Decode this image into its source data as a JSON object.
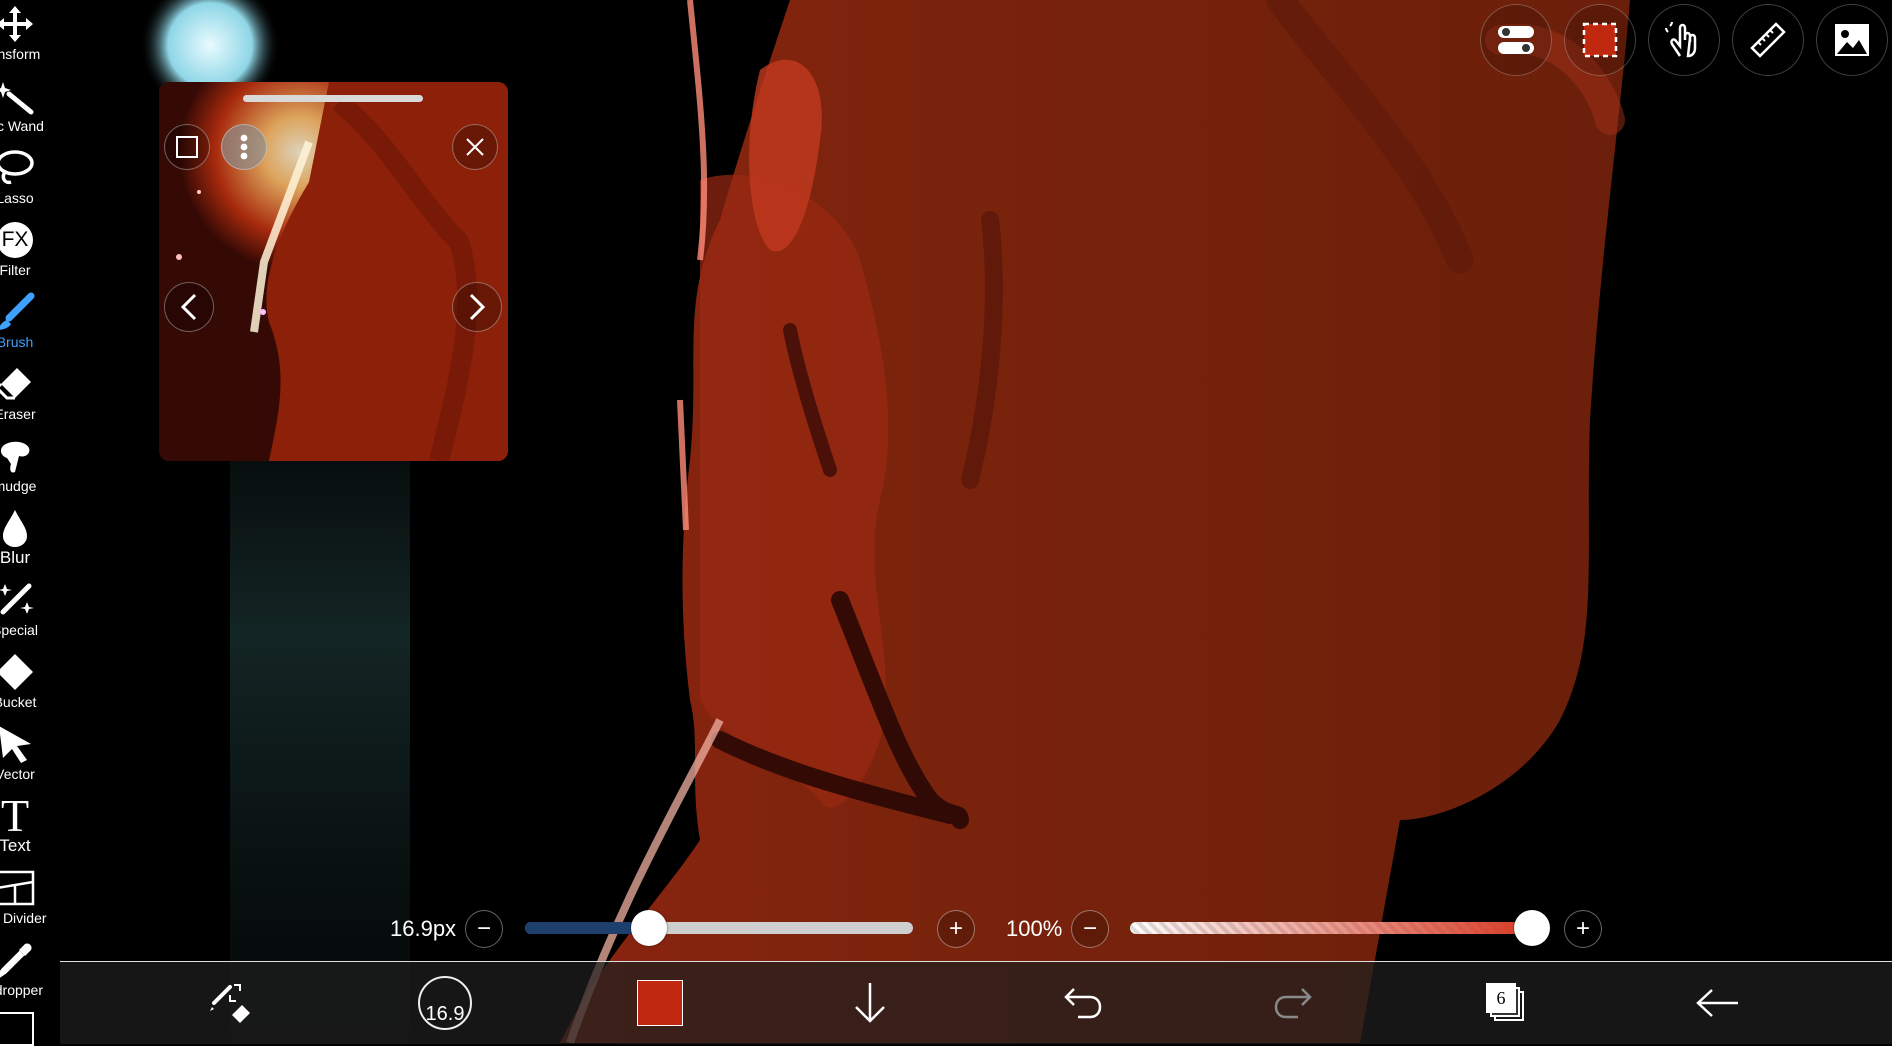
{
  "toolbar": {
    "tools": [
      {
        "label": "ansform",
        "icon": "move-arrows-icon"
      },
      {
        "label": "gic Wand",
        "icon": "magic-wand-icon"
      },
      {
        "label": "Lasso",
        "icon": "lasso-icon"
      },
      {
        "label": "Filter",
        "icon": "fx-icon"
      },
      {
        "label": "Brush",
        "icon": "brush-icon",
        "active": true
      },
      {
        "label": "Eraser",
        "icon": "eraser-icon"
      },
      {
        "label": "mudge",
        "icon": "smudge-icon"
      },
      {
        "label": "Blur",
        "icon": "drop-icon"
      },
      {
        "label": "Special",
        "icon": "sparkle-brush-icon"
      },
      {
        "label": "Bucket",
        "icon": "bucket-icon"
      },
      {
        "label": "Vector",
        "icon": "vector-arrow-icon"
      },
      {
        "label": "Text",
        "icon": "text-icon"
      },
      {
        "label": "ne Divider",
        "icon": "frame-divider-icon"
      },
      {
        "label": "edropper",
        "icon": "eyedropper-icon"
      }
    ]
  },
  "reference": {
    "icons": [
      "square-icon",
      "more-icon",
      "close-icon",
      "previous-icon",
      "next-icon"
    ]
  },
  "top_actions": [
    "toggle-icon",
    "selection-icon",
    "touch-icon",
    "ruler-icon",
    "image-icon"
  ],
  "sliders": {
    "size": {
      "text": "16.9px",
      "fill": 0.32
    },
    "opacity": {
      "text": "100%",
      "fill": 1.0
    },
    "minus": "−",
    "plus": "+"
  },
  "bottom_bar": {
    "brush_size_text": "16.9",
    "current_color": "#c0290f",
    "layers_count": "6",
    "icons": [
      "brush-eraser-swap-icon",
      "brush-size-icon",
      "color-swatch-icon",
      "download-icon",
      "undo-icon",
      "redo-icon",
      "layers-icon",
      "back-icon"
    ]
  },
  "colors": {
    "accent": "#3ea0ff",
    "slider_left": "#1d3f6e",
    "opacity_red": "#d63a24"
  }
}
